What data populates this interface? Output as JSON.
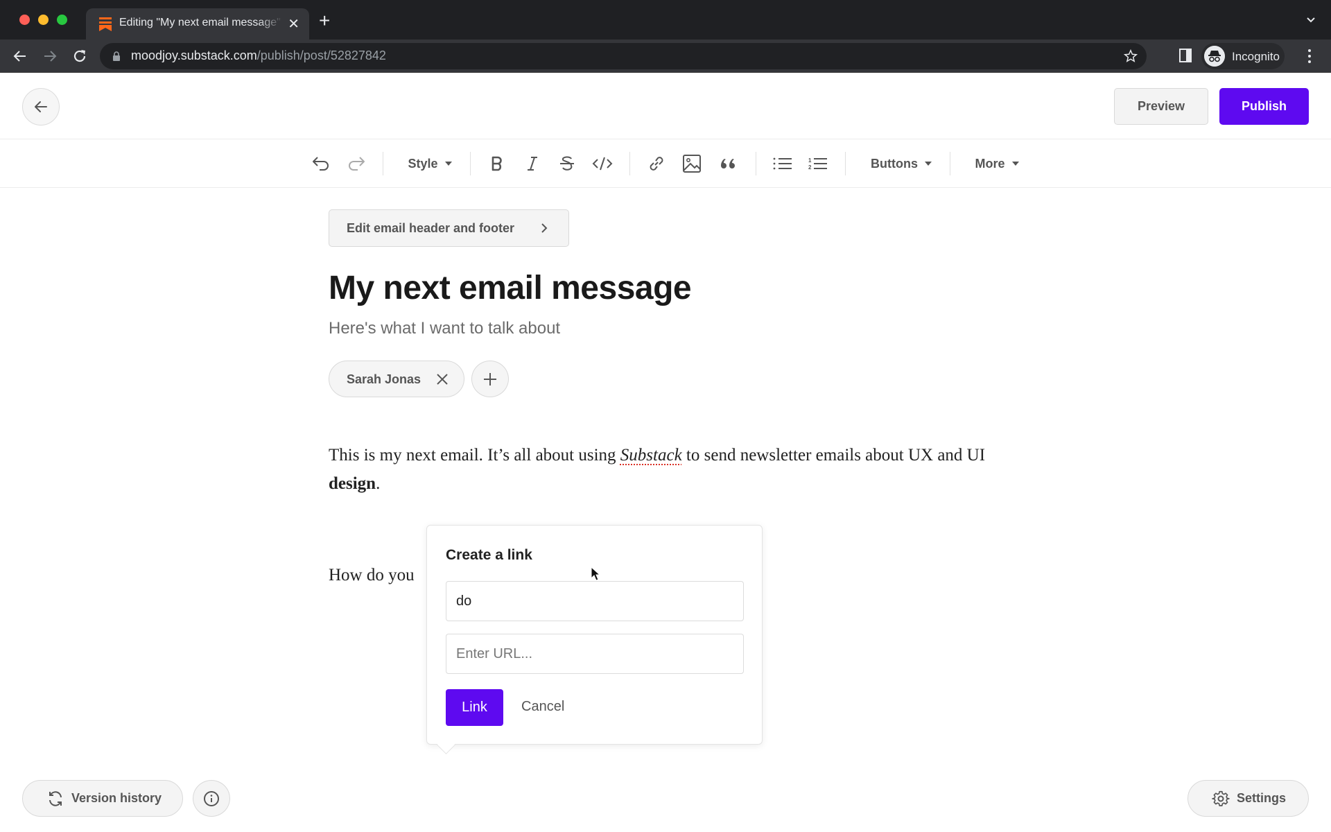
{
  "browser": {
    "tab_title": "Editing \"My next email message\"",
    "url_host": "moodjoy.substack.com",
    "url_path": "/publish/post/52827842",
    "profile_label": "Incognito",
    "favicon_color": "#ff6719"
  },
  "header": {
    "back_icon": "arrow-left-icon",
    "preview_label": "Preview",
    "publish_label": "Publish",
    "accent_color": "#5e0af0"
  },
  "toolbar": {
    "items": [
      {
        "name": "undo",
        "icon": "undo-icon"
      },
      {
        "name": "redo",
        "icon": "redo-icon"
      },
      {
        "name": "style",
        "label": "Style"
      },
      {
        "name": "bold",
        "icon": "bold-icon"
      },
      {
        "name": "italic",
        "icon": "italic-icon"
      },
      {
        "name": "strikethrough",
        "icon": "strikethrough-icon"
      },
      {
        "name": "code",
        "icon": "code-icon"
      },
      {
        "name": "link",
        "icon": "link-icon"
      },
      {
        "name": "image",
        "icon": "image-icon"
      },
      {
        "name": "quote",
        "icon": "quote-icon"
      },
      {
        "name": "bullet-list",
        "icon": "bullet-list-icon"
      },
      {
        "name": "numbered-list",
        "icon": "numbered-list-icon"
      },
      {
        "name": "buttons",
        "label": "Buttons"
      },
      {
        "name": "more",
        "label": "More"
      }
    ],
    "style_label": "Style",
    "buttons_label": "Buttons",
    "more_label": "More"
  },
  "post": {
    "edit_header_footer_label": "Edit email header and footer",
    "title": "My next email message",
    "subtitle": "Here's what I want to talk about",
    "author": "Sarah Jonas",
    "body_p1_a": "This is my next email. It’s all about using ",
    "body_p1_italic": "Substack",
    "body_p1_b": " to send newsletter emails about UX and UI ",
    "body_p1_bold": "design",
    "body_p1_end": ".",
    "body_p2": "How do you"
  },
  "link_popover": {
    "title": "Create a link",
    "text_value": "do",
    "url_placeholder": "Enter URL...",
    "url_value": "",
    "link_label": "Link",
    "cancel_label": "Cancel"
  },
  "footer": {
    "version_history_label": "Version history",
    "settings_label": "Settings"
  }
}
